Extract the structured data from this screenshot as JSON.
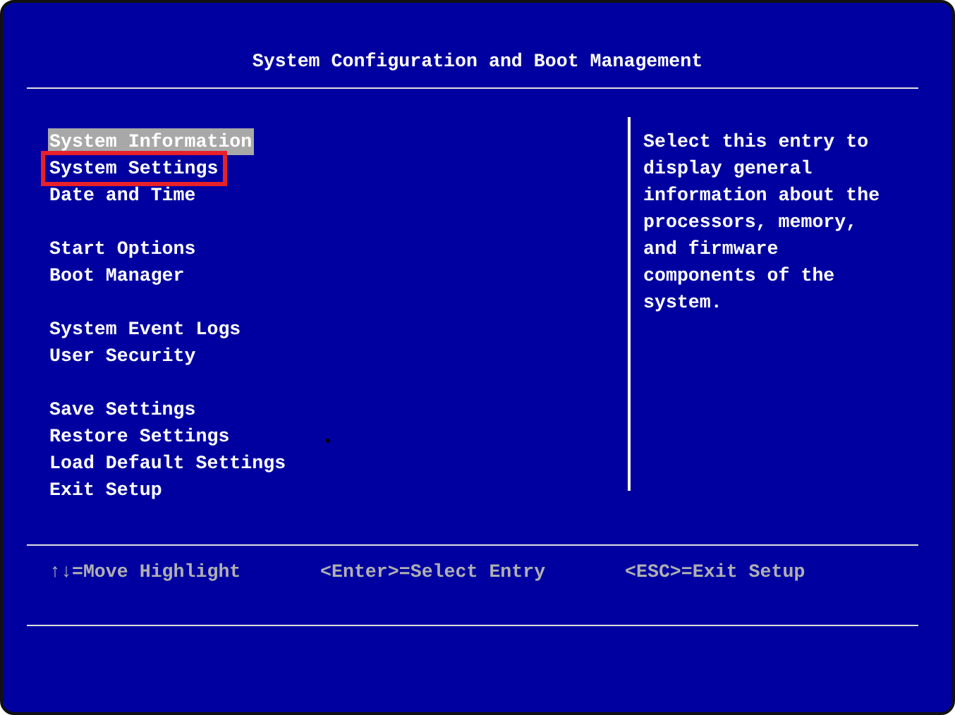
{
  "title": "System Configuration and Boot Management",
  "menu_groups": [
    {
      "items": [
        {
          "label": "System Information",
          "selected": true,
          "annotated": false
        },
        {
          "label": "System Settings",
          "selected": false,
          "annotated": true
        },
        {
          "label": "Date and Time",
          "selected": false,
          "annotated": false
        }
      ]
    },
    {
      "items": [
        {
          "label": "Start Options",
          "selected": false,
          "annotated": false
        },
        {
          "label": "Boot Manager",
          "selected": false,
          "annotated": false
        }
      ]
    },
    {
      "items": [
        {
          "label": "System Event Logs",
          "selected": false,
          "annotated": false
        },
        {
          "label": "User Security",
          "selected": false,
          "annotated": false
        }
      ]
    },
    {
      "items": [
        {
          "label": "Save Settings",
          "selected": false,
          "annotated": false
        },
        {
          "label": "Restore Settings",
          "selected": false,
          "annotated": false
        },
        {
          "label": "Load Default Settings",
          "selected": false,
          "annotated": false
        },
        {
          "label": "Exit Setup",
          "selected": false,
          "annotated": false
        }
      ]
    }
  ],
  "help_lines": [
    "Select this entry to",
    "display general",
    "information about the",
    "processors, memory,",
    "and firmware",
    "components of the",
    "system."
  ],
  "key_hints": [
    "↑↓=Move Highlight",
    "<Enter>=Select Entry",
    "<ESC>=Exit Setup"
  ]
}
